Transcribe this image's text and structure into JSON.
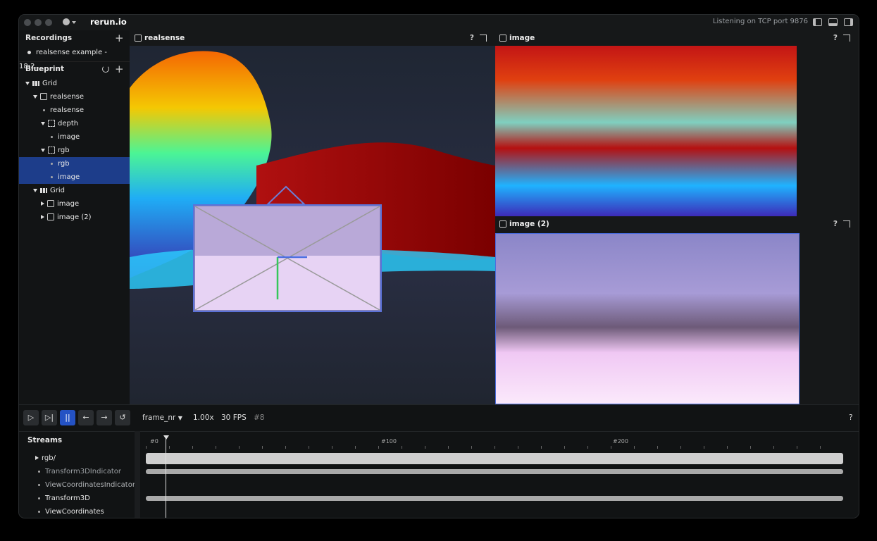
{
  "titlebar": {
    "app_title": "rerun.io",
    "status": "Listening on TCP port 9876"
  },
  "left_panel": {
    "recordings_label": "Recordings",
    "recording_item": "realsense example - 18:2...",
    "blueprint_label": "Blueprint",
    "tree": [
      {
        "label": "Grid",
        "icon": "grid-icon",
        "indent": 0,
        "expand": "down"
      },
      {
        "label": "realsense",
        "icon": "space-3d-icon",
        "indent": 1,
        "expand": "down"
      },
      {
        "label": "realsense",
        "icon": "dot",
        "indent": 2
      },
      {
        "label": "depth",
        "icon": "group-icon",
        "indent": 2,
        "expand": "down"
      },
      {
        "label": "image",
        "icon": "dot",
        "indent": 3
      },
      {
        "label": "rgb",
        "icon": "group-icon",
        "indent": 2,
        "expand": "down"
      },
      {
        "label": "rgb",
        "icon": "dot",
        "indent": 3,
        "selected": true
      },
      {
        "label": "image",
        "icon": "dot",
        "indent": 3,
        "selected": true
      },
      {
        "label": "Grid",
        "icon": "grid-icon",
        "indent": 1,
        "expand": "down"
      },
      {
        "label": "image",
        "icon": "image-icon",
        "indent": 2,
        "expand": "right"
      },
      {
        "label": "image (2)",
        "icon": "image-icon",
        "indent": 2,
        "expand": "right"
      }
    ]
  },
  "views": {
    "realsense_title": "realsense",
    "image_title": "image",
    "image2_title": "image (2)",
    "help_glyph": "?"
  },
  "timeline": {
    "timeline_name": "frame_nr",
    "speed": "1.00x",
    "fps": "30 FPS",
    "current_frame": "#8",
    "help_glyph": "?",
    "streams_label": "Streams",
    "streams": [
      "rgb/",
      "Transform3DIndicator",
      "ViewCoordinatesIndicator",
      "Transform3D",
      "ViewCoordinates"
    ],
    "ticks": [
      "#0",
      "#100",
      "#200"
    ]
  },
  "colors": {
    "accent": "#2452c4",
    "selection": "#1d3d8a"
  }
}
